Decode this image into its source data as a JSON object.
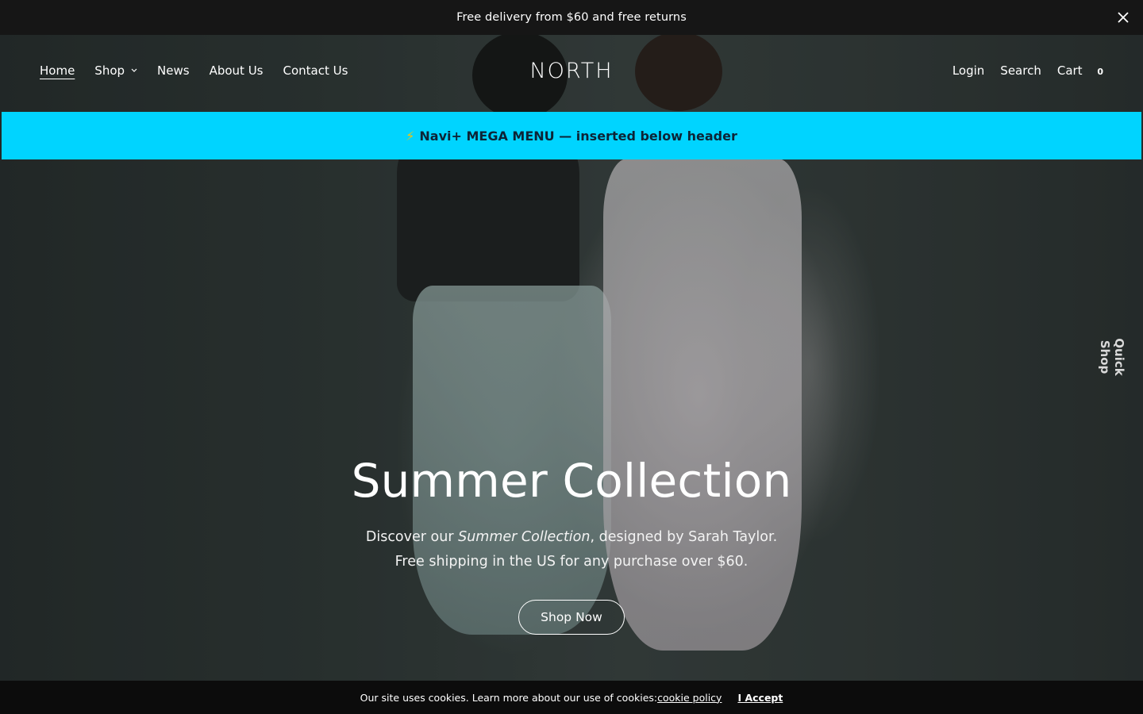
{
  "announcement": {
    "text": "Free delivery from $60 and free returns",
    "close_icon": "close-icon"
  },
  "header": {
    "logo": "NORTH",
    "nav_left": [
      {
        "label": "Home",
        "active": true
      },
      {
        "label": "Shop",
        "has_dropdown": true
      },
      {
        "label": "News"
      },
      {
        "label": "About Us"
      },
      {
        "label": "Contact Us"
      }
    ],
    "nav_right": {
      "login": "Login",
      "search": "Search",
      "cart": "Cart",
      "cart_count": "0"
    }
  },
  "mega_menu": {
    "icon": "⚡",
    "text": "Navi+ MEGA MENU — inserted below header",
    "background_color": "#00d4ff"
  },
  "hero": {
    "title": "Summer Collection",
    "subtitle_pre": "Discover our ",
    "subtitle_em": "Summer Collection",
    "subtitle_post": ", designed by Sarah Taylor.",
    "subtitle_line2": "Free shipping in the US for any purchase over $60.",
    "button": "Shop Now"
  },
  "quick_shop": "Quick Shop",
  "cookie_bar": {
    "text": "Our site uses cookies. Learn more about our use of cookies: ",
    "policy_link": "cookie policy",
    "accept": "I Accept"
  }
}
